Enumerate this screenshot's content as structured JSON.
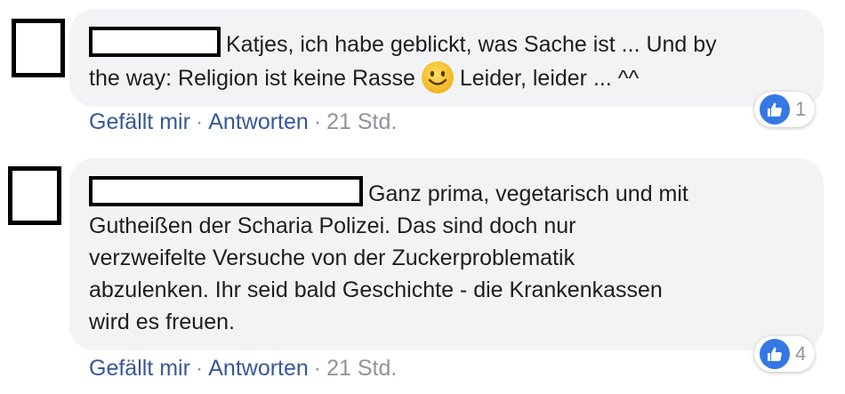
{
  "comments": [
    {
      "text_lines": [
        "Katjes, ich habe geblickt, was Sache ist ... Und by",
        "the way: Religion ist keine Rasse"
      ],
      "text_after_emoji": "Leider, leider ... ^^",
      "emoji": "slightly-smiling-face",
      "reaction_count": "1",
      "like_label": "Gefällt mir",
      "reply_label": "Antworten",
      "separator": "·",
      "timestamp": "21 Std."
    },
    {
      "text_lines": [
        "Ganz prima, vegetarisch und mit",
        "Gutheißen der Scharia Polizei. Das sind doch nur",
        "verzweifelte Versuche von der Zuckerproblematik",
        "abzulenken. Ihr seid bald Geschichte - die Krankenkassen",
        "wird es freuen."
      ],
      "reaction_count": "4",
      "like_label": "Gefällt mir",
      "reply_label": "Antworten",
      "separator": "·",
      "timestamp": "21 Std."
    }
  ],
  "colors": {
    "bubble": "#f2f3f5",
    "link": "#385898",
    "meta": "#90949c",
    "like_blue": "#3578e5",
    "text": "#1c1e21"
  },
  "icons": {
    "reaction": "thumbs-up-icon",
    "emoji": "smiley-icon"
  }
}
